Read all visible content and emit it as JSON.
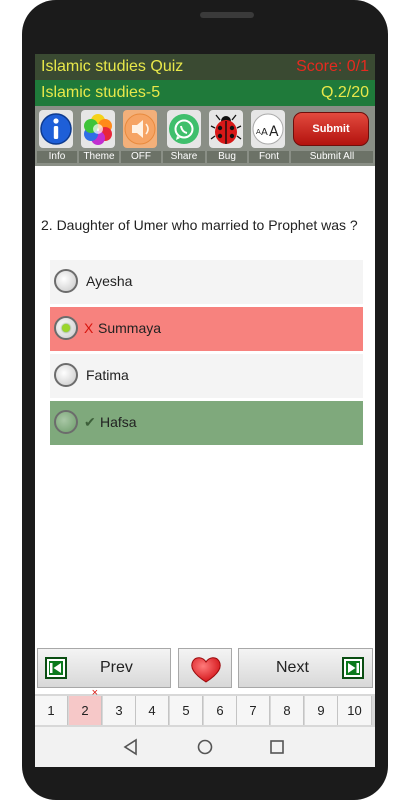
{
  "header": {
    "app_title": "Islamic studies Quiz",
    "score": "Score: 0/1",
    "quiz_name": "Islamic studies-5",
    "question_counter": "Q.2/20"
  },
  "toolbar": {
    "items": [
      {
        "label": "Info",
        "icon": "info-icon"
      },
      {
        "label": "Theme",
        "icon": "theme-icon"
      },
      {
        "label": "OFF",
        "icon": "speaker-icon"
      },
      {
        "label": "Share",
        "icon": "whatsapp-icon"
      },
      {
        "label": "Bug",
        "icon": "ladybug-icon"
      },
      {
        "label": "Font",
        "icon": "font-size-icon"
      }
    ],
    "submit_label": "Submit",
    "submit_all_label": "Submit All"
  },
  "question": {
    "text": "2. Daughter of Umer who married to Prophet was ?"
  },
  "options": [
    {
      "text": "Ayesha",
      "state": "neutral",
      "mark": ""
    },
    {
      "text": "Summaya",
      "state": "wrong",
      "mark": "X"
    },
    {
      "text": "Fatima",
      "state": "neutral",
      "mark": ""
    },
    {
      "text": "Hafsa",
      "state": "correct",
      "mark": "✔"
    }
  ],
  "navigation": {
    "prev_label": "Prev",
    "next_label": "Next"
  },
  "pages": [
    "1",
    "2",
    "3",
    "4",
    "5",
    "6",
    "7",
    "8",
    "9",
    "10"
  ],
  "page_error_mark": "×",
  "colors": {
    "header_dark": "#3a4a32",
    "header_green": "#1f7a3a",
    "title_yellow": "#e8e84a",
    "score_red": "#e52a1f",
    "wrong_bg": "#f7827e",
    "correct_bg": "#7fa97c",
    "submit_red": "#c41a16"
  }
}
